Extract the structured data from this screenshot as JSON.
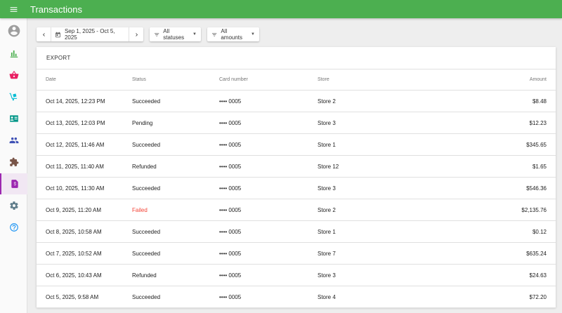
{
  "header": {
    "title": "Transactions",
    "menu_icon": "menu-icon"
  },
  "sidebar": {
    "items": [
      {
        "name": "account",
        "icon": "account-circle-icon",
        "color": "#9e9e9e"
      },
      {
        "name": "analytics",
        "icon": "bar-chart-icon",
        "color": "#4caf50"
      },
      {
        "name": "orders",
        "icon": "basket-icon",
        "color": "#e91e63"
      },
      {
        "name": "delivery",
        "icon": "dolly-icon",
        "color": "#00bcd4"
      },
      {
        "name": "customers",
        "icon": "contact-card-icon",
        "color": "#009688"
      },
      {
        "name": "users",
        "icon": "people-icon",
        "color": "#3f51b5"
      },
      {
        "name": "integrations",
        "icon": "puzzle-icon",
        "color": "#795548"
      },
      {
        "name": "transactions",
        "icon": "receipt-dollar-icon",
        "color": "#9c27b0",
        "active": true
      },
      {
        "name": "settings",
        "icon": "gear-icon",
        "color": "#607d8b"
      },
      {
        "name": "help",
        "icon": "help-circle-icon",
        "color": "#2196f3"
      }
    ]
  },
  "filters": {
    "date_range": "Sep 1, 2025 - Oct 5, 2025",
    "status": "All statuses",
    "amount": "All amounts"
  },
  "card": {
    "export_label": "EXPORT"
  },
  "table": {
    "headers": {
      "date": "Date",
      "status": "Status",
      "card": "Card number",
      "store": "Store",
      "amount": "Amount"
    },
    "rows": [
      {
        "date": "Oct 14, 2025, 12:23 PM",
        "status": "Succeeded",
        "card": "•••• 0005",
        "store": "Store 2",
        "amount": "$8.48"
      },
      {
        "date": "Oct 13, 2025, 12:03 PM",
        "status": "Pending",
        "card": "•••• 0005",
        "store": "Store 3",
        "amount": "$12.23"
      },
      {
        "date": "Oct 12, 2025, 11:46 AM",
        "status": "Succeeded",
        "card": "•••• 0005",
        "store": "Store 1",
        "amount": "$345.65"
      },
      {
        "date": "Oct 11, 2025, 11:40 AM",
        "status": "Refunded",
        "card": "•••• 0005",
        "store": "Store 12",
        "amount": "$1.65"
      },
      {
        "date": "Oct 10, 2025, 11:30 AM",
        "status": "Succeeded",
        "card": "•••• 0005",
        "store": "Store 3",
        "amount": "$546.36"
      },
      {
        "date": "Oct 9, 2025, 11:20 AM",
        "status": "Failed",
        "card": "•••• 0005",
        "store": "Store 2",
        "amount": "$2,135.76"
      },
      {
        "date": "Oct 8, 2025, 10:58 AM",
        "status": "Succeeded",
        "card": "•••• 0005",
        "store": "Store 1",
        "amount": "$0.12"
      },
      {
        "date": "Oct 7, 2025, 10:52 AM",
        "status": "Succeeded",
        "card": "•••• 0005",
        "store": "Store 7",
        "amount": "$635.24"
      },
      {
        "date": "Oct 6, 2025, 10:43 AM",
        "status": "Refunded",
        "card": "•••• 0005",
        "store": "Store 3",
        "amount": "$24.63"
      },
      {
        "date": "Oct 5, 2025, 9:58 AM",
        "status": "Succeeded",
        "card": "•••• 0005",
        "store": "Store 4",
        "amount": "$72.20"
      }
    ]
  },
  "colors": {
    "primary": "#4caf50",
    "failed": "#f44336",
    "active_nav": "#9c27b0"
  }
}
